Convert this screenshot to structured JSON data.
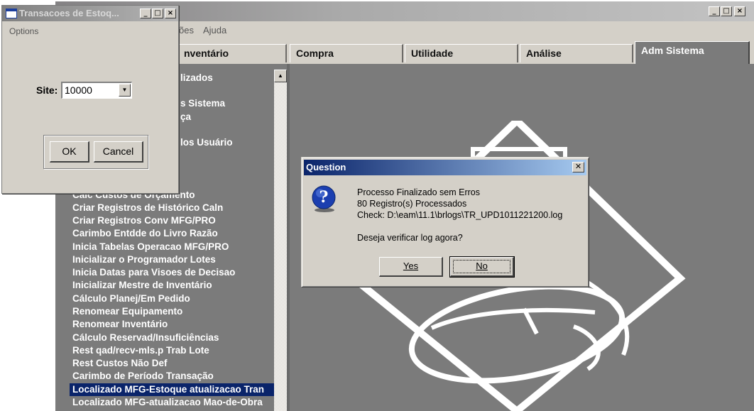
{
  "main_window": {
    "menu": {
      "partial_item": "ões",
      "ajuda": "Ajuda"
    },
    "tabs": [
      {
        "label": "nventário"
      },
      {
        "label": "Compra"
      },
      {
        "label": "Utilidade"
      },
      {
        "label": "Análise"
      },
      {
        "label": "Adm Sistema",
        "active": true
      }
    ],
    "upper_items": [
      "lizados",
      "s Sistema",
      "ça",
      "los Usuário"
    ],
    "module_items": [
      "Calc Custos de Orçamento",
      "Criar Registros de Histórico Caln",
      "Criar Registros Conv MFG/PRO",
      "Carimbo Entdde do Livro Razão",
      "Inicia Tabelas Operacao MFG/PRO",
      "Inicializar o Programador Lotes",
      "Inicia Datas para Visoes de Decisao",
      "Inicializar Mestre de Inventário",
      "Cálculo Planej/Em Pedido",
      "Renomear Equipamento",
      "Renomear Inventário",
      "Cálculo Reservad/Insuficiências",
      "Rest qad/recv-mls.p Trab Lote",
      "Rest Custos Não Def",
      "Carimbo de Período Transação",
      "Localizado MFG-Estoque atualizacao Tran",
      "Localizado MFG-atualizacao Mao-de-Obra"
    ],
    "selected_item": "Localizado MFG-Estoque atualizacao Tran"
  },
  "small_window": {
    "title": "Transacoes de Estoq...",
    "menu_options": "Options",
    "site_label": "Site:",
    "site_value": "10000",
    "ok_label": "OK",
    "cancel_label": "Cancel"
  },
  "dialog": {
    "title": "Question",
    "icon": "question-icon",
    "message_lines": [
      "Processo Finalizado sem Erros",
      "80 Registro(s) Processados",
      "Check:  D:\\eam\\11.1\\brlogs\\TR_UPD1011221200.log",
      "Deseja verificar log agora?"
    ],
    "yes_label": "Yes",
    "no_label": "No"
  },
  "colors": {
    "window_bg": "#d4d0c8",
    "content_bg": "#7b7b7b",
    "dialog_title_start": "#0a246a",
    "selection": "#0a246a"
  }
}
